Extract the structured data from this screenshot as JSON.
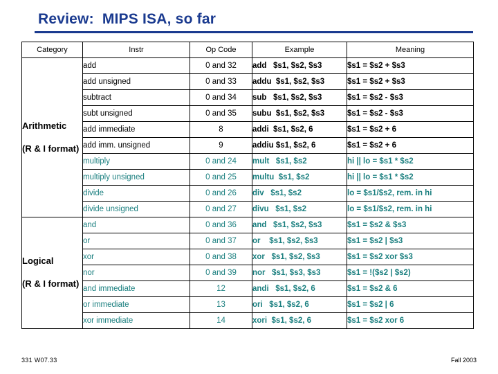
{
  "slide": {
    "title": "Review:  MIPS ISA, so far",
    "footer_left": "331 W07.33",
    "footer_right": "Fall 2003",
    "accent_color": "#1a3a8f",
    "teal_color": "#1a7f7f"
  },
  "table": {
    "headers": [
      "Category",
      "Instr",
      "Op Code",
      "Example",
      "Meaning"
    ],
    "groups": [
      {
        "category_lines": [
          "Arithmetic",
          "(R & I format)"
        ],
        "rows": [
          {
            "instr": "add",
            "color": "black",
            "op": "0 and 32",
            "example": "add   $s1, $s2, $s3",
            "meaning": "$s1 = $s2 + $s3"
          },
          {
            "instr": "add unsigned",
            "color": "black",
            "op": "0 and 33",
            "example": "addu  $s1, $s2, $s3",
            "meaning": "$s1 = $s2 + $s3"
          },
          {
            "instr": "subtract",
            "color": "black",
            "op": "0 and 34",
            "example": "sub   $s1, $s2, $s3",
            "meaning": "$s1 = $s2 - $s3"
          },
          {
            "instr": "subt unsigned",
            "color": "black",
            "op": "0 and 35",
            "example": "subu  $s1, $s2, $s3",
            "meaning": "$s1 = $s2 - $s3"
          },
          {
            "instr": "add immediate",
            "color": "black",
            "op": "8",
            "example": "addi  $s1, $s2, 6",
            "meaning": "$s1 = $s2 + 6"
          },
          {
            "instr": "add imm. unsigned",
            "color": "black",
            "op": "9",
            "example": "addiu $s1, $s2, 6",
            "meaning": "$s1 = $s2 + 6"
          },
          {
            "instr": "multiply",
            "color": "teal",
            "op": "0 and 24",
            "example": "mult   $s1, $s2",
            "meaning": "hi || lo = $s1 * $s2"
          },
          {
            "instr": "multiply unsigned",
            "color": "teal",
            "op": "0 and 25",
            "example": "multu  $s1, $s2",
            "meaning": "hi || lo = $s1 * $s2"
          },
          {
            "instr": "divide",
            "color": "teal",
            "op": "0 and 26",
            "example": "div   $s1, $s2",
            "meaning": "lo = $s1/$s2, rem. in hi"
          },
          {
            "instr": "divide unsigned",
            "color": "teal",
            "op": "0 and 27",
            "example": "divu   $s1, $s2",
            "meaning": "lo = $s1/$s2, rem. in hi"
          }
        ]
      },
      {
        "category_lines": [
          "Logical",
          "(R & I format)"
        ],
        "rows": [
          {
            "instr": "and",
            "color": "teal",
            "op": "0 and 36",
            "example": "and   $s1, $s2, $s3",
            "meaning": "$s1 = $s2 & $s3"
          },
          {
            "instr": "or",
            "color": "teal",
            "op": "0 and 37",
            "example": "or    $s1, $s2, $s3",
            "meaning": "$s1 = $s2 | $s3"
          },
          {
            "instr": "xor",
            "color": "teal",
            "op": "0 and 38",
            "example": "xor   $s1, $s2, $s3",
            "meaning": "$s1 = $s2 xor $s3"
          },
          {
            "instr": "nor",
            "color": "teal",
            "op": "0 and 39",
            "example": "nor   $s1, $s3, $s3",
            "meaning": "$s1 = !($s2 | $s2)"
          },
          {
            "instr": "and immediate",
            "color": "teal",
            "op": "12",
            "example": "andi   $s1, $s2, 6",
            "meaning": "$s1 = $s2 & 6"
          },
          {
            "instr": "or immediate",
            "color": "teal",
            "op": "13",
            "example": "ori   $s1, $s2, 6",
            "meaning": "$s1 = $s2 | 6"
          },
          {
            "instr": "xor immediate",
            "color": "teal",
            "op": "14",
            "example": "xori  $s1, $s2, 6",
            "meaning": "$s1 = $s2 xor 6"
          }
        ]
      }
    ]
  }
}
